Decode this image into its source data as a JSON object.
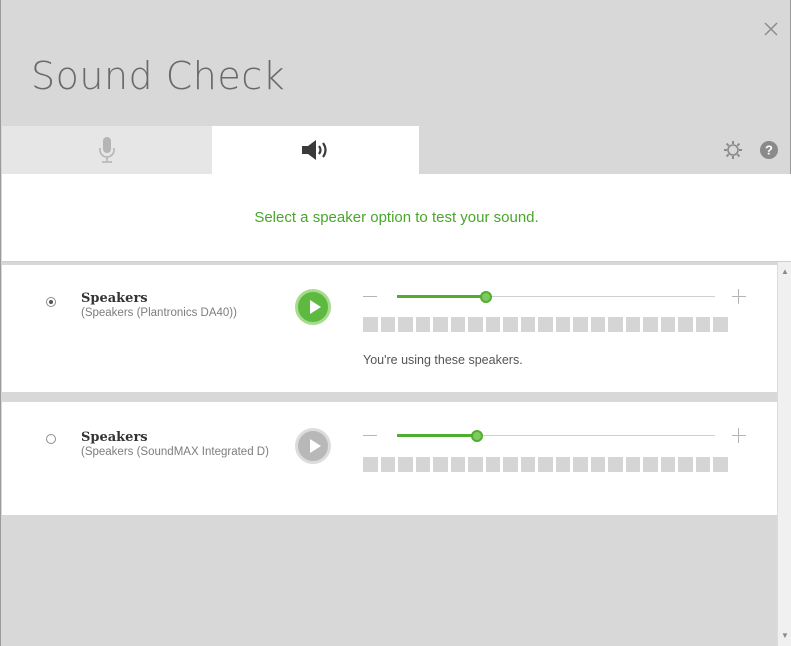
{
  "window": {
    "title": "Sound Check",
    "close_icon": "close-icon"
  },
  "tabs": [
    {
      "id": "microphone",
      "icon": "microphone-icon",
      "selected": false
    },
    {
      "id": "speakers",
      "icon": "speaker-volume-icon",
      "selected": true
    }
  ],
  "toolbar": {
    "settings_icon": "gear-icon",
    "help_icon": "help-icon"
  },
  "instruction": "Select a speaker option to test your sound.",
  "devices": [
    {
      "name": "Speakers",
      "detail": "(Speakers (Plantronics DA40))",
      "selected": true,
      "play_state": "active",
      "volume_fraction": 0.28,
      "status": "You're using these speakers."
    },
    {
      "name": "Speakers",
      "detail": "(Speakers (SoundMAX Integrated D)",
      "selected": false,
      "play_state": "inactive",
      "volume_fraction": 0.25,
      "status": ""
    }
  ],
  "colors": {
    "accent_green": "#49a62b",
    "window_bg": "#d8d8d8",
    "card_bg": "#ffffff"
  }
}
